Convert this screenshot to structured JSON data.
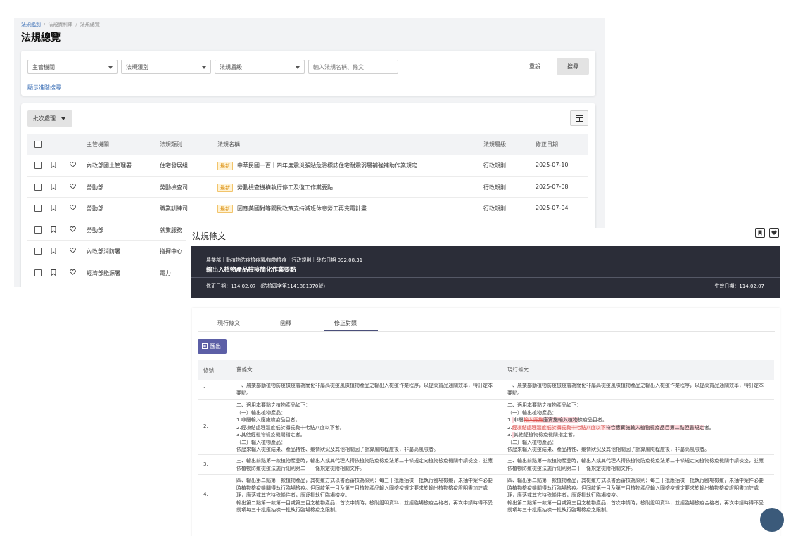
{
  "list_page": {
    "breadcrumb": [
      "法規鑑別",
      "法規資料庫",
      "法規總覽"
    ],
    "title": "法規總覽",
    "filters": {
      "agency": "主管機關",
      "category": "法規類別",
      "level": "法規層級",
      "keyword_placeholder": "輸入法規名稱、條文"
    },
    "reset_label": "重設",
    "search_label": "搜尋",
    "advanced_label": "顯示進階搜尋",
    "batch_label": "批次處理",
    "columns": [
      "主管機關",
      "法規類別",
      "法規名稱",
      "法規層級",
      "修正日期"
    ],
    "new_badge": "最新",
    "rows": [
      {
        "agency": "內政部國土管理署",
        "category": "住宅發展組",
        "name": "中華民國一百十四年度震災張貼危險標誌住宅耐震弱層補強補助作業規定",
        "level": "行政規則",
        "date": "2025-07-10",
        "is_new": true
      },
      {
        "agency": "勞動部",
        "category": "勞動檢查司",
        "name": "勞動檢查機構執行停工及復工作業要點",
        "level": "行政規則",
        "date": "2025-07-08",
        "is_new": true
      },
      {
        "agency": "勞動部",
        "category": "職業訓練司",
        "name": "因應美國對等關稅政策支持減班休息勞工再充電計畫",
        "level": "行政規則",
        "date": "2025-07-04",
        "is_new": true
      },
      {
        "agency": "勞動部",
        "category": "就業服務",
        "name": "",
        "level": "",
        "date": "",
        "is_new": false
      },
      {
        "agency": "內政部消防署",
        "category": "指揮中心",
        "name": "",
        "level": "",
        "date": "",
        "is_new": false
      },
      {
        "agency": "經濟部能源署",
        "category": "電力",
        "name": "",
        "level": "",
        "date": "",
        "is_new": false
      }
    ]
  },
  "detail": {
    "title": "法規條文",
    "meta": "農業部｜動植物防疫檢疫署/植物檢疫｜行政規則｜發布日期 092.08.31",
    "law_name": "輸出入植物產品檢疫簡化作業要點",
    "amend": "修正日期：114.02.07 （防檢四字第1141881370號）",
    "effective": "生效日期：114.02.07",
    "tabs": [
      "現行條文",
      "函釋",
      "修正對照"
    ],
    "export_label": "匯出",
    "cmp_headers": {
      "no": "條號",
      "old": "舊條文",
      "new": "現行條文"
    },
    "cmp_rows": [
      {
        "no": "1.",
        "old": "一、農業部動植物防疫檢疫署為簡化非屬高檢疫風險植物產品之輸出入檢疫作業程序，以提高貨品通關效率，特訂定本要點。",
        "new": "一、農業部動植物防疫檢疫署為簡化非屬高檢疫風險植物產品之輸出入檢疫作業程序，以提高貨品通關效率，特訂定本要點。"
      },
      {
        "no": "2.",
        "old": [
          "二、適用本要點之植物產品如下：",
          "（一）輸出植物產品：",
          "1.非屬輸入應施檢疫品目者。",
          "2.經凍結處理溫度低於攝氏負十七點八度以下者。",
          "3.其他經植物檢疫機關指定者。",
          "（二）輸入植物產品：",
          "依歷來輸入檢疫結果、產品特性、疫情狀況及其他相關因子計算風險程度後，非屬高風險者。"
        ],
        "new_lines": {
          "l1": "二、適用本要點之植物產品如下：",
          "l2": "（一）輸出植物產品：",
          "l3a": "1.",
          "l3b": "非屬",
          "l3del": "輸入應施",
          "l3ins": "應實施輸入植物",
          "l3c": "檢疫品目者。",
          "l4a": "2.",
          "l4del": "經凍結處理溫度低於攝氏負十七點八度以下",
          "l4ins": "符合應實施輸入植物檢疫品目第二點但書規定",
          "l4c": "者。",
          "l5a": "3.",
          "l5b": "其他經植物檢疫機關指定者。",
          "l6": "（二）輸入植物產品：",
          "l7": "依歷來輸入檢疫結果、產品特性、疫情狀況及其他相關因子計算風險程度後，非屬高風險者。"
        }
      },
      {
        "no": "3.",
        "old": "三、輸出前點第一款植物產品時，輸出人或其代理人得依植物防疫檢疫法第二十條規定向植物檢疫機關申請檢疫，並應依植物防疫檢疫法施行細則第二十一條規定檢附相關文件。",
        "new": "三、輸出前點第一款植物產品時，輸出人或其代理人得依植物防疫檢疫法第二十條規定向植物檢疫機關申請檢疫，並應依植物防疫檢疫法施行細則第二十一條規定檢附相關文件。"
      },
      {
        "no": "4.",
        "old": [
          "四、輸出第二點第一款植物產品，其檢疫方式以書面審核為原則；每三十批應抽檢一批執行臨場檢疫，未抽中案件必要時植物檢疫機關得執行臨場檢疫。但同款第一目及第三目植物產品輸入國檢疫規定要求於輸出植物檢疫證明書加註處理，應落或其它特殊條件者，應逐批執行臨場檢疫。",
          "輸出第二點第一款第一目或第三目之植物產品，首次申請時，檢附證明資料，並經臨場檢疫合格者，再次申請時得不受前項每三十批應抽檢一批執行臨場檢疫之限制。"
        ],
        "new": [
          "四、輸出第二點第一款植物產品，其檢疫方式以書面審核為原則；每三十批應抽檢一批執行臨場檢疫，未抽中案件必要時植物檢疫機關得執行臨場檢疫。但同款第一目及第三目植物產品輸入國檢疫規定要求於輸出植物檢疫證明書加註處理，應落或其它特殊條件者，應逐批執行臨場檢疫。",
          "輸出第二點第一款第一目或第三目之植物產品，首次申請時，檢附證明資料，並經臨場檢疫合格者，再次申請時得不受前項每三十批應抽檢一批執行臨場檢疫之限制。"
        ]
      }
    ]
  },
  "colors": {
    "accent": "#5c5fa6",
    "banner": "#2b2d38",
    "new_badge": "#d88700",
    "link": "#3b6fb6"
  }
}
